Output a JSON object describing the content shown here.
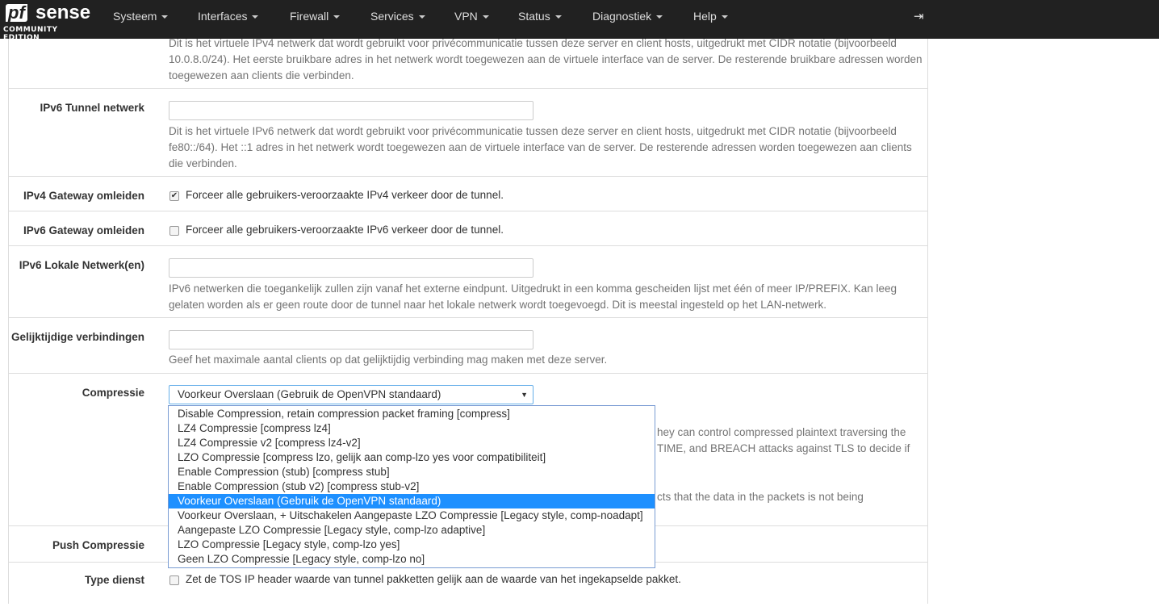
{
  "nav": {
    "logo_main": "pfsense",
    "logo_sub": "COMMUNITY EDITION",
    "menus": [
      "Systeem",
      "Interfaces",
      "Firewall",
      "Services",
      "VPN",
      "Status",
      "Diagnostiek",
      "Help"
    ]
  },
  "rows": {
    "ipv4_tunnel_help": "Dit is het virtuele IPv4 netwerk dat wordt gebruikt voor privécommunicatie tussen deze server en client hosts, uitgedrukt met CIDR notatie (bijvoorbeeld 10.0.8.0/24). Het eerste bruikbare adres in het netwerk wordt toegewezen aan de virtuele interface van de server. De resterende bruikbare adressen worden toegewezen aan clients die verbinden.",
    "ipv6_tunnel_label": "IPv6 Tunnel netwerk",
    "ipv6_tunnel_value": "",
    "ipv6_tunnel_help": "Dit is het virtuele IPv6 netwerk dat wordt gebruikt voor privécommunicatie tussen deze server en client hosts, uitgedrukt met CIDR notatie (bijvoorbeeld fe80::/64). Het ::1 adres in het netwerk wordt toegewezen aan de virtuele interface van de server. De resterende adressen worden toegewezen aan clients die verbinden.",
    "ipv4_gw_label": "IPv4 Gateway omleiden",
    "ipv4_gw_text": "Forceer alle gebruikers-veroorzaakte IPv4 verkeer door de tunnel.",
    "ipv4_gw_checked": true,
    "ipv6_gw_label": "IPv6 Gateway omleiden",
    "ipv6_gw_text": "Forceer alle gebruikers-veroorzaakte IPv6 verkeer door de tunnel.",
    "ipv6_gw_checked": false,
    "ipv6_local_label": "IPv6 Lokale Netwerk(en)",
    "ipv6_local_value": "",
    "ipv6_local_help": "IPv6 netwerken die toegankelijk zullen zijn vanaf het externe eindpunt. Uitgedrukt in een komma gescheiden lijst met één of meer IP/PREFIX. Kan leeg gelaten worden als er geen route door de tunnel naar het lokale netwerk wordt toegevoegd. Dit is meestal ingesteld op het LAN-netwerk.",
    "concurrent_label": "Gelijktijdige verbindingen",
    "concurrent_value": "",
    "concurrent_help": "Geef het maximale aantal clients op dat gelijktijdig verbinding mag maken met deze server.",
    "compress_label": "Compressie",
    "compress_selected": "Voorkeur Overslaan (Gebruik de OpenVPN standaard)",
    "compress_help_frags": [
      "hey can control compressed plaintext traversing the",
      "TIME, and BREACH attacks against TLS to decide if",
      "cts that the data in the packets is not being"
    ],
    "compress_options": [
      "Disable Compression, retain compression packet framing [compress]",
      "LZ4 Compressie [compress lz4]",
      "LZ4 Compressie v2 [compress lz4-v2]",
      "LZO Compressie [compress lzo, gelijk aan comp-lzo yes voor compatibiliteit]",
      "Enable Compression (stub) [compress stub]",
      "Enable Compression (stub v2) [compress stub-v2]",
      "Voorkeur Overslaan (Gebruik de OpenVPN standaard)",
      "Voorkeur Overslaan, + Uitschakelen Aangepaste LZO Compressie [Legacy style, comp-noadapt]",
      "Aangepaste LZO Compressie [Legacy style, comp-lzo adaptive]",
      "LZO Compressie [Legacy style, comp-lzo yes]",
      "Geen LZO Compressie [Legacy style, comp-lzo no]"
    ],
    "push_label": "Push Compressie",
    "tos_label": "Type dienst",
    "tos_text": "Zet de TOS IP header waarde van tunnel pakketten gelijk aan de waarde van het ingekapselde pakket.",
    "tos_checked": false
  }
}
